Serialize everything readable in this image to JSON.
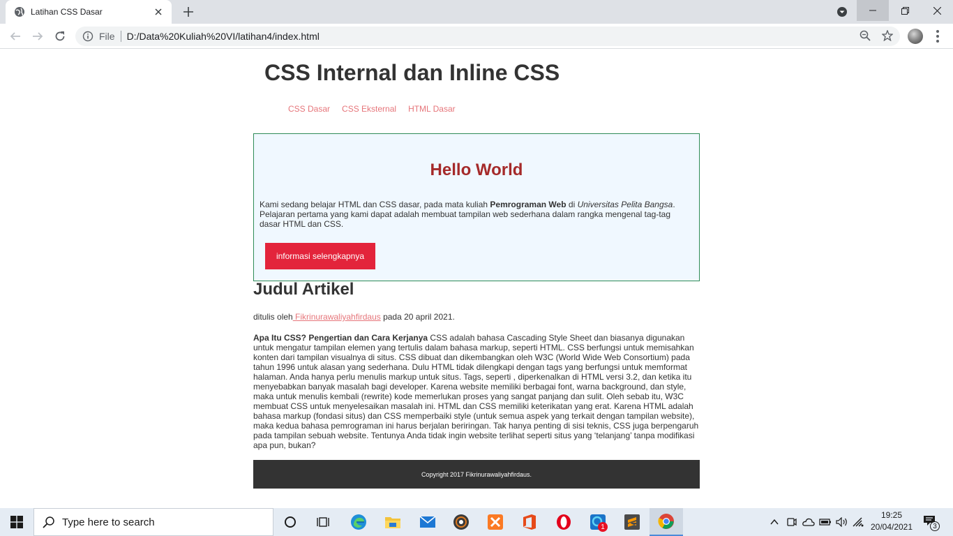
{
  "browser": {
    "tab_title": "Latihan CSS Dasar",
    "address_scheme": "File",
    "address_url": "D:/Data%20Kuliah%20VI/latihan4/index.html"
  },
  "page": {
    "title": "CSS Internal dan Inline CSS",
    "nav": [
      "CSS Dasar",
      "CSS Eksternal",
      "HTML Dasar"
    ],
    "hero": {
      "heading": "Hello World",
      "text_1": "Kami sedang belajar HTML dan CSS dasar, pada mata kuliah ",
      "text_bold": "Pemrograman Web",
      "text_2": " di ",
      "text_italic": "Universitas Pelita Bangsa",
      "text_3": ". Pelajaran pertama yang kami dapat adalah membuat tampilan web sederhana dalam rangka mengenal tag-tag dasar HTML dan CSS.",
      "button": "informasi selengkapnya"
    },
    "article": {
      "heading": "Judul Artikel",
      "byline_prefix": "ditulis oleh",
      "author": " Fikrinurawaliyahfirdaus",
      "byline_suffix": " pada 20 april 2021.",
      "lead_bold": "Apa Itu CSS? Pengertian dan Cara Kerjanya",
      "body": " CSS adalah bahasa Cascading Style Sheet dan biasanya digunakan untuk mengatur tampilan elemen yang tertulis dalam bahasa markup, seperti HTML. CSS berfungsi untuk memisahkan konten dari tampilan visualnya di situs. CSS dibuat dan dikembangkan oleh W3C (World Wide Web Consortium) pada tahun 1996 untuk alasan yang sederhana. Dulu HTML tidak dilengkapi dengan tags yang berfungsi untuk memformat halaman. Anda hanya perlu menulis markup untuk situs. Tags, seperti , diperkenalkan di HTML versi 3.2, dan ketika itu menyebabkan banyak masalah bagi developer. Karena website memiliki berbagai font, warna background, dan style, maka untuk menulis kembali (rewrite) kode memerlukan proses yang sangat panjang dan sulit. Oleh sebab itu, W3C membuat CSS untuk menyelesaikan masalah ini. HTML dan CSS memiliki keterikatan yang erat. Karena HTML adalah bahasa markup (fondasi situs) dan CSS memperbaiki style (untuk semua aspek yang terkait dengan tampilan website), maka kedua bahasa pemrograman ini harus berjalan beriringan. Tak hanya penting di sisi teknis, CSS juga berpengaruh pada tampilan sebuah website. Tentunya Anda tidak ingin website terlihat seperti situs yang ‘telanjang’ tanpa modifikasi apa pun, bukan?"
    },
    "footer": "Copyright 2017 Fikrinurawaliyahfirdaus."
  },
  "taskbar": {
    "search_placeholder": "Type here to search",
    "clock_time": "19:25",
    "clock_date": "20/04/2021",
    "app_badge": "1",
    "notification_count": "3",
    "apps": [
      "task-view",
      "edge",
      "file-explorer",
      "mail",
      "media-player",
      "xampp",
      "office",
      "opera",
      "store",
      "sublime-text",
      "chrome"
    ]
  },
  "colors": {
    "link": "#e6757a",
    "hero_heading": "#a52a2a",
    "hero_bg": "#f0f8ff",
    "hero_border": "#2e8b57",
    "button": "#e3243b",
    "footer_bg": "#333333"
  }
}
